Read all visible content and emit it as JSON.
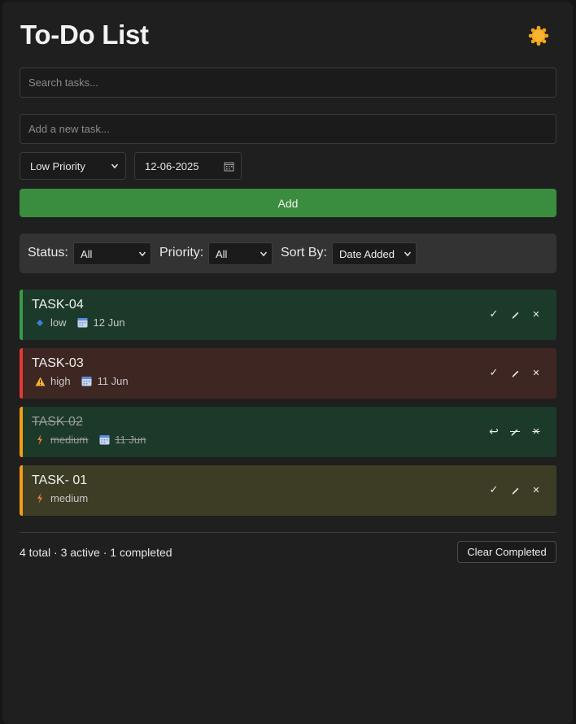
{
  "app": {
    "title": "To-Do List",
    "theme_icon": "sun-icon"
  },
  "search": {
    "placeholder": "Search tasks..."
  },
  "new_task": {
    "placeholder": "Add a new task...",
    "priority_selected": "Low Priority",
    "date_value": "12-06-2025",
    "add_label": "Add"
  },
  "filters": {
    "status_label": "Status:",
    "status_value": "All",
    "priority_label": "Priority:",
    "priority_value": "All",
    "sort_label": "Sort By:",
    "sort_value": "Date Added"
  },
  "tasks": [
    {
      "name": "TASK-04",
      "priority": "low",
      "date": "12 Jun",
      "completed": false,
      "priority_icon": "diamond-icon",
      "color_bg": "#1c3a2a",
      "color_border": "#3a9a44"
    },
    {
      "name": "TASK-03",
      "priority": "high",
      "date": "11 Jun",
      "completed": false,
      "priority_icon": "warning-icon",
      "color_bg": "#3e2622",
      "color_border": "#e53935"
    },
    {
      "name": "TASK 02",
      "priority": "medium",
      "date": "11 Jun",
      "completed": true,
      "priority_icon": "lightning-icon",
      "color_bg": "#1c3a2a",
      "color_border": "#f39c12"
    },
    {
      "name": "TASK- 01",
      "priority": "medium",
      "date": "",
      "completed": false,
      "priority_icon": "lightning-icon",
      "color_bg": "#3d3d25",
      "color_border": "#f39c12"
    }
  ],
  "footer": {
    "summary": "4 total · 3 active · 1 completed",
    "clear_label": "Clear Completed"
  }
}
